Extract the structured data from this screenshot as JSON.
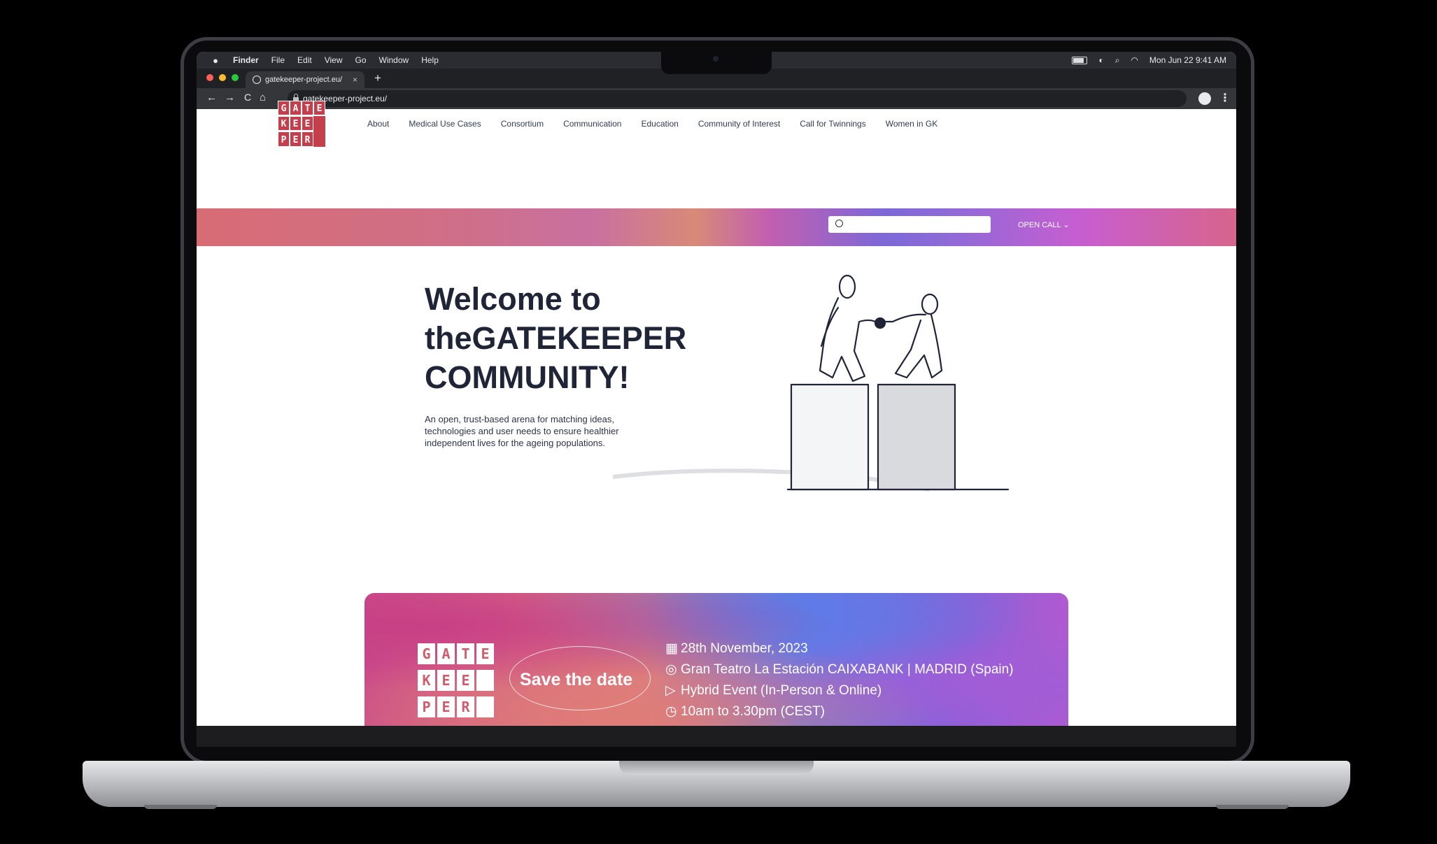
{
  "menubar": {
    "apple": "",
    "items": [
      "Finder",
      "File",
      "Edit",
      "View",
      "Go",
      "Window",
      "Help"
    ],
    "clock": "Mon Jun 22  9:41 AM"
  },
  "browser": {
    "tab_title": "gatekeeper-project.eu/",
    "tab_close": "×",
    "new_tab": "+",
    "url": "gatekeeper-project.eu/",
    "nav": {
      "back": "←",
      "forward": "→",
      "reload": "C",
      "home": "⌂"
    },
    "menu": "⋮"
  },
  "site": {
    "logo": {
      "letters": [
        "G",
        "A",
        "T",
        "E",
        "K",
        "E",
        "E",
        "P",
        "E",
        "R"
      ]
    },
    "nav": [
      "About",
      "Medical Use Cases",
      "Consortium",
      "Communication",
      "Education",
      "Community of Interest",
      "Call for Twinnings",
      "Women in GK"
    ],
    "search_placeholder": "",
    "open_call": "OPEN CALL ⌄",
    "hero": {
      "title_line1": "Welcome to",
      "title_line2": "theGATEKEEPER",
      "title_line3": "COMMUNITY!",
      "subtitle": "An open, trust-based arena for matching ideas, technologies and user needs to ensure healthier independent lives for the ageing populations."
    },
    "save_date": {
      "label": "Save the date",
      "logo_letters": [
        "G",
        "A",
        "T",
        "E",
        "K",
        "E",
        "E",
        "P",
        "E",
        "R"
      ],
      "date": "28th November, 2023",
      "venue": "Gran Teatro La Estación CAIXABANK | MADRID (Spain)",
      "format": "Hybrid Event (In-Person & Online)",
      "time": "10am to 3.30pm (CEST)"
    }
  },
  "colors": {
    "brand": "#c43e4c",
    "heading": "#1f2437",
    "traffic_lights": [
      "#ff5f57",
      "#febc2e",
      "#28c840"
    ]
  }
}
